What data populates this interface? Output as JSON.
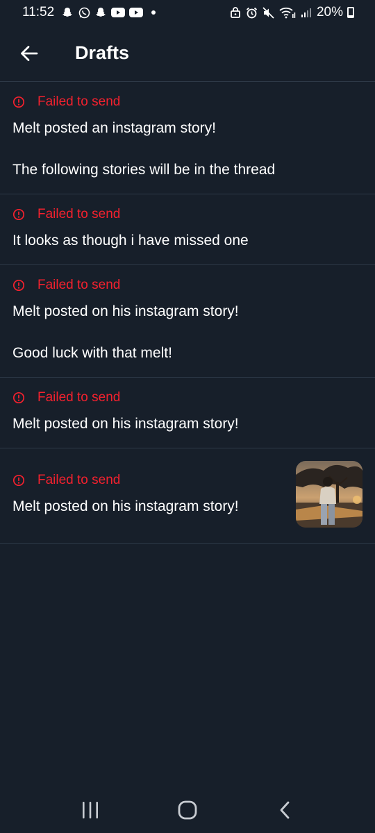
{
  "status_bar": {
    "time": "11:52",
    "battery": "20%",
    "left_icons": [
      "snapchat-icon",
      "whatsapp-icon",
      "snapchat-icon",
      "youtube-icon",
      "youtube-icon"
    ],
    "right_icons": [
      "lock-icon",
      "alarm-icon",
      "mute-icon",
      "wifi-icon",
      "signal-icon",
      "battery-icon"
    ]
  },
  "header": {
    "title": "Drafts",
    "back_icon": "arrow-left-icon"
  },
  "colors": {
    "background": "#171f2a",
    "divider": "#2e3a48",
    "error": "#f4212e",
    "text": "#ffffff"
  },
  "drafts": [
    {
      "status": "Failed to send",
      "paragraphs": [
        "Melt posted an instagram story!",
        "The following stories will be in the thread"
      ]
    },
    {
      "status": "Failed to send",
      "paragraphs": [
        "It looks as though i have missed one"
      ]
    },
    {
      "status": "Failed to send",
      "paragraphs": [
        "Melt posted on his instagram story!",
        "Good luck with that melt!"
      ]
    },
    {
      "status": "Failed to send",
      "paragraphs": [
        "Melt posted on his instagram story!"
      ]
    },
    {
      "status": "Failed to send",
      "paragraphs": [
        "Melt posted on his instagram story!"
      ],
      "has_media": true
    }
  ],
  "nav_bar": {
    "icons": [
      "recents-icon",
      "home-icon",
      "back-chevron-icon"
    ]
  }
}
